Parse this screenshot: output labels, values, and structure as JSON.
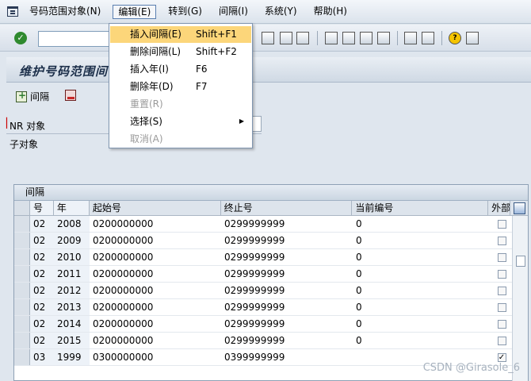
{
  "menubar": {
    "items": [
      "号码范围对象(N)",
      "编辑(E)",
      "转到(G)",
      "间隔(I)",
      "系统(Y)",
      "帮助(H)"
    ]
  },
  "title": "维护号码范围间",
  "app_toolbar": {
    "interval_label": "间隔"
  },
  "form": {
    "nr_label": "NR 对象",
    "sub_label": "子对象"
  },
  "table": {
    "title": "间隔",
    "headers": [
      "号",
      "年",
      "起始号",
      "终止号",
      "当前编号",
      "外部"
    ],
    "rows": [
      {
        "no": "02",
        "year": "2008",
        "start": "0200000000",
        "end": "0299999999",
        "current": "0",
        "external": false
      },
      {
        "no": "02",
        "year": "2009",
        "start": "0200000000",
        "end": "0299999999",
        "current": "0",
        "external": false
      },
      {
        "no": "02",
        "year": "2010",
        "start": "0200000000",
        "end": "0299999999",
        "current": "0",
        "external": false
      },
      {
        "no": "02",
        "year": "2011",
        "start": "0200000000",
        "end": "0299999999",
        "current": "0",
        "external": false
      },
      {
        "no": "02",
        "year": "2012",
        "start": "0200000000",
        "end": "0299999999",
        "current": "0",
        "external": false
      },
      {
        "no": "02",
        "year": "2013",
        "start": "0200000000",
        "end": "0299999999",
        "current": "0",
        "external": false
      },
      {
        "no": "02",
        "year": "2014",
        "start": "0200000000",
        "end": "0299999999",
        "current": "0",
        "external": false
      },
      {
        "no": "02",
        "year": "2015",
        "start": "0200000000",
        "end": "0299999999",
        "current": "0",
        "external": false
      },
      {
        "no": "03",
        "year": "1999",
        "start": "0300000000",
        "end": "0399999999",
        "current": "",
        "external": true
      }
    ]
  },
  "dropdown": {
    "items": [
      {
        "label": "插入间隔(E)",
        "shortcut": "Shift+F1",
        "highlighted": true,
        "disabled": false,
        "submenu": false
      },
      {
        "label": "删除间隔(L)",
        "shortcut": "Shift+F2",
        "highlighted": false,
        "disabled": false,
        "submenu": false
      },
      {
        "label": "插入年(I)",
        "shortcut": "F6",
        "highlighted": false,
        "disabled": false,
        "submenu": false
      },
      {
        "label": "删除年(D)",
        "shortcut": "F7",
        "highlighted": false,
        "disabled": false,
        "submenu": false
      },
      {
        "label": "重置(R)",
        "shortcut": "",
        "highlighted": false,
        "disabled": true,
        "submenu": false
      },
      {
        "label": "选择(S)",
        "shortcut": "",
        "highlighted": false,
        "disabled": false,
        "submenu": true
      },
      {
        "label": "取消(A)",
        "shortcut": "",
        "highlighted": false,
        "disabled": true,
        "submenu": false
      }
    ]
  },
  "watermark": "CSDN @Girasole_6",
  "colors": {
    "menu_highlight": "#fcd67a",
    "required_marker": "#cc0000"
  }
}
